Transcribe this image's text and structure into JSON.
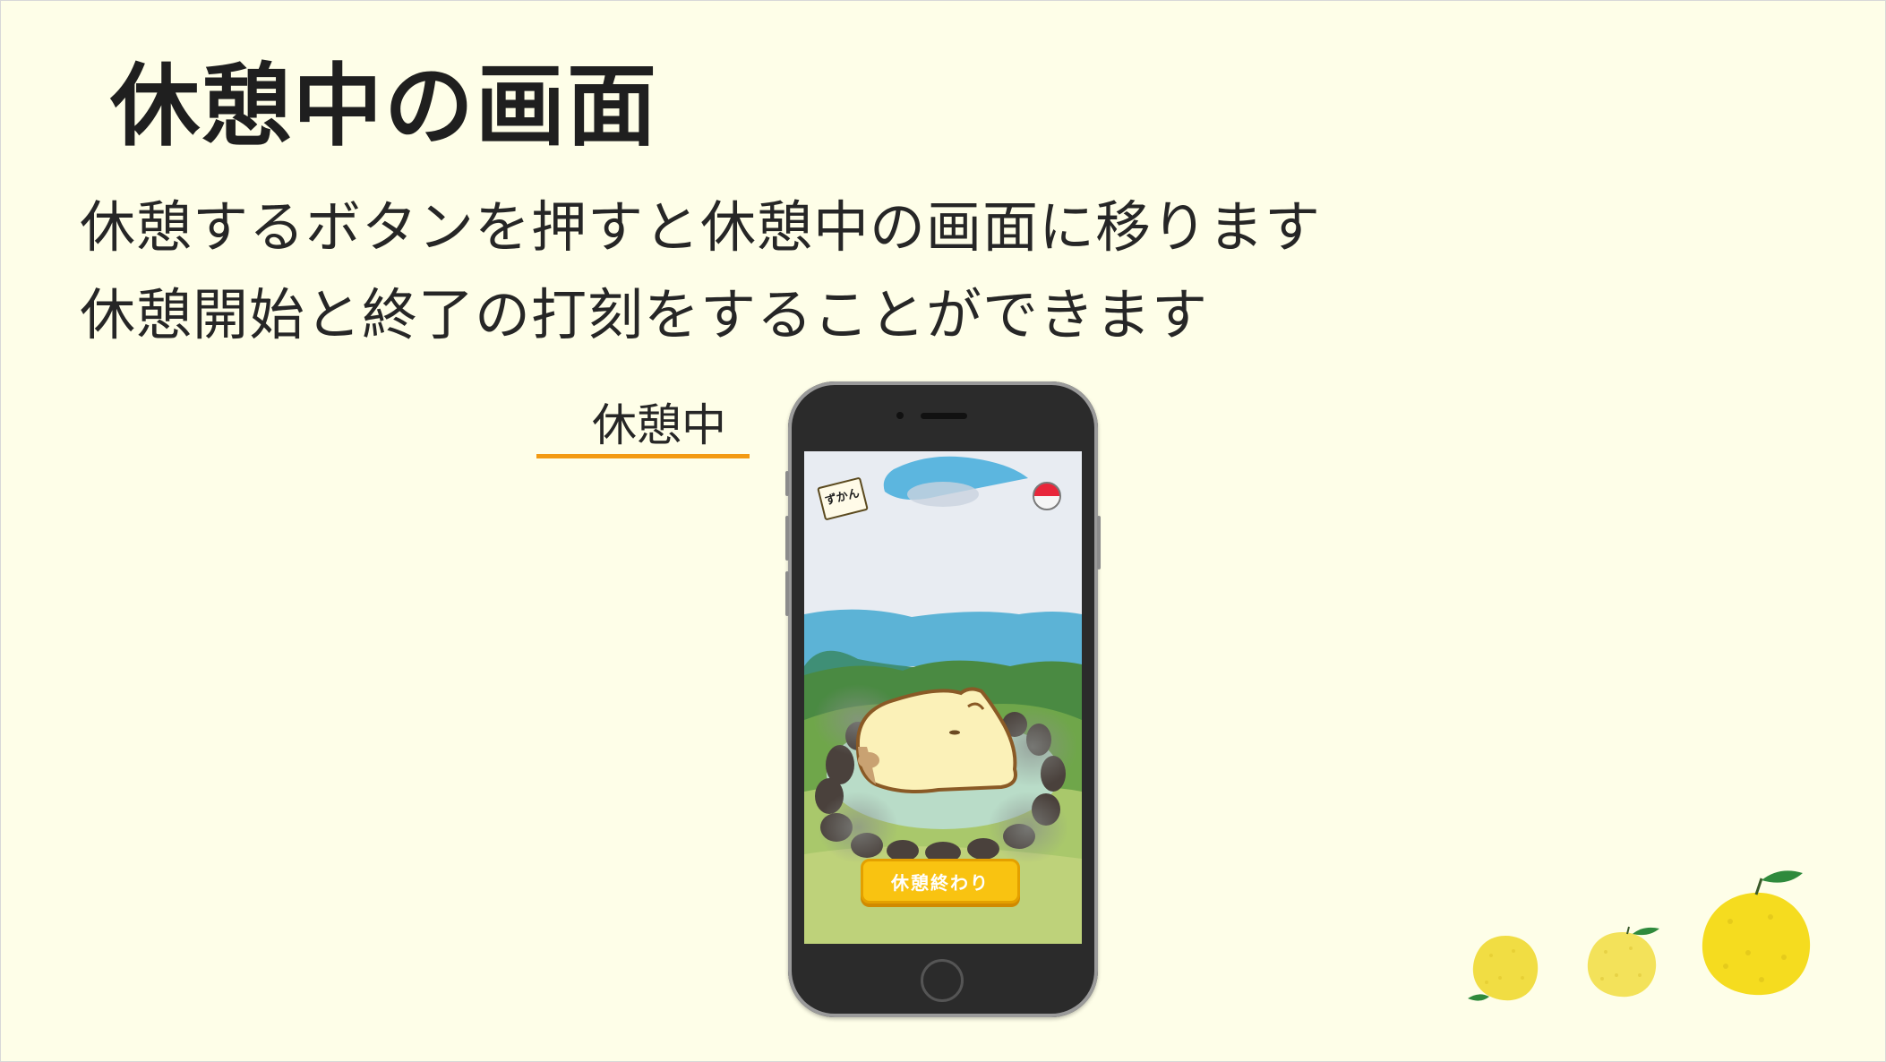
{
  "slide": {
    "title": "休憩中の画面",
    "description_lines": [
      "休憩するボタンを押すと休憩中の画面に移ります",
      "休憩開始と終了の打刻をすることができます"
    ],
    "screen_label": "休憩中"
  },
  "app_screen": {
    "zukan_label": "ずかん",
    "end_break_button": "休憩終わり"
  },
  "colors": {
    "background": "#fefee8",
    "label_underline": "#f39a12",
    "button": "#f9c311",
    "yuzu": "#f3e13a"
  },
  "icons": [
    "zukan-book-icon",
    "ball-icon",
    "yuzu-fruit-icon"
  ]
}
